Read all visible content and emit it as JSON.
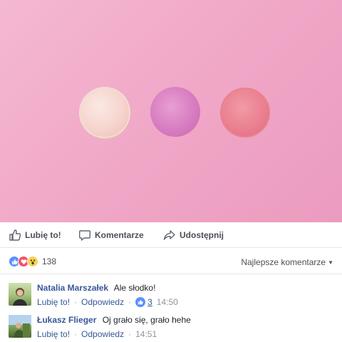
{
  "actions": {
    "like": "Lubię to!",
    "comment": "Komentarze",
    "share": "Udostępnij"
  },
  "reactions": {
    "icons": [
      "like-icon",
      "love-icon",
      "wow-icon"
    ],
    "count": "138"
  },
  "sort": {
    "label": "Najlepsze komentarze"
  },
  "comments": [
    {
      "author": "Natalia Marszałek",
      "text": "Ale słodko!",
      "like_label": "Lubię to!",
      "reply_label": "Odpowiedz",
      "likes": "3",
      "time": "14:50"
    },
    {
      "author": "Łukasz Flieger",
      "text": "Oj grało się, grało hehe",
      "like_label": "Lubię to!",
      "reply_label": "Odpowiedz",
      "time": "14:51"
    }
  ],
  "colors": {
    "link": "#365899",
    "background_photo": "#f0a6c6",
    "like_blue": "#5890ff",
    "love_red": "#f25268",
    "wow_yellow": "#f7d358"
  }
}
